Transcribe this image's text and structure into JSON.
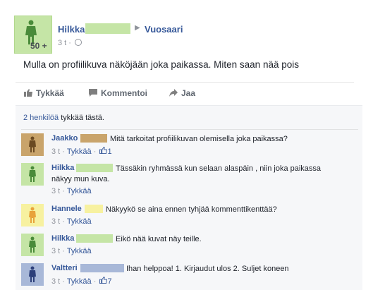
{
  "post": {
    "age_badge": "50 +",
    "author": "Hilkka",
    "group": "Vuosaari",
    "time": "3 t ·",
    "text": "Mulla on profiilikuva näköjään joka paikassa. Miten saan nää pois"
  },
  "actions": {
    "like": "Tykkää",
    "comment": "Kommentoi",
    "share": "Jaa"
  },
  "likes": {
    "link": "2 henkilöä",
    "suffix": "tykkää tästä."
  },
  "comments": [
    {
      "name": "Jaakko",
      "text": "Mitä tarkoitat profiilikuvan olemisella joka paikassa?",
      "time": "3 t ·",
      "like": "Tykkää",
      "likes": "1",
      "avatar_color": "#c9a46b",
      "redact_color": "#c9a46b"
    },
    {
      "name": "Hilkka",
      "text": "Tässäkin ryhmässä kun selaan alaspäin , niin joka paikassa",
      "text2": "näkyy mun kuva.",
      "time": "3 t ·",
      "like": "Tykkää",
      "likes": "",
      "avatar_color": "#c5e5a6",
      "redact_color": "#c5e5a6"
    },
    {
      "name": "Hannele",
      "text": "Näkyykö se aina ennen tyhjää kommenttikenttää?",
      "time": "3 t ·",
      "like": "Tykkää",
      "likes": "",
      "avatar_color": "#f7f1a0",
      "redact_color": "#f7f1a0"
    },
    {
      "name": "Hilkka",
      "text": "Eikö nää kuvat näy teille.",
      "time": "3 t ·",
      "like": "Tykkää",
      "likes": "",
      "avatar_color": "#c5e5a6",
      "redact_color": "#c5e5a6"
    },
    {
      "name": "Valtteri",
      "text": "Ihan helppoa! 1. Kirjaudut ulos 2. Suljet koneen",
      "time": "3 t ·",
      "like": "Tykkää",
      "likes": "7",
      "avatar_color": "#a8b8d8",
      "redact_color": "#a8b8d8"
    }
  ]
}
